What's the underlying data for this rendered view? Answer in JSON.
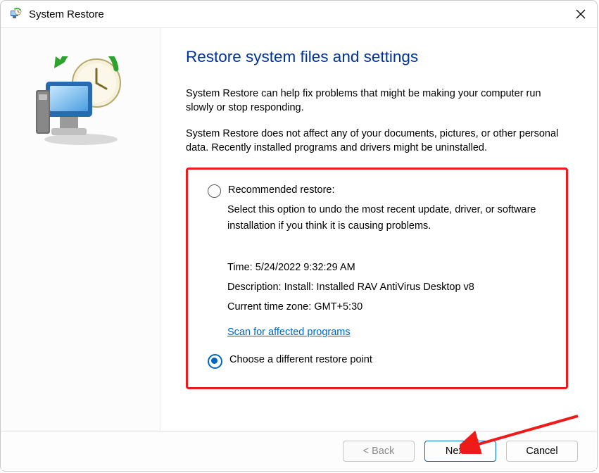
{
  "window": {
    "title": "System Restore"
  },
  "main": {
    "heading": "Restore system files and settings",
    "intro1": "System Restore can help fix problems that might be making your computer run slowly or stop responding.",
    "intro2": "System Restore does not affect any of your documents, pictures, or other personal data. Recently installed programs and drivers might be uninstalled."
  },
  "options": {
    "recommended": {
      "label": "Recommended restore:",
      "desc": "Select this option to undo the most recent update, driver, or software installation if you think it is causing problems.",
      "time_label": "Time: ",
      "time_value": "5/24/2022 9:32:29 AM",
      "desc_label": "Description: ",
      "desc_value": "Install: Installed RAV AntiVirus Desktop v8",
      "tz_label": "Current time zone: ",
      "tz_value": "GMT+5:30",
      "scan_link": "Scan for affected programs",
      "selected": false
    },
    "different": {
      "label": "Choose a different restore point",
      "selected": true
    }
  },
  "footer": {
    "back": "< Back",
    "next": "Next >",
    "cancel": "Cancel"
  }
}
